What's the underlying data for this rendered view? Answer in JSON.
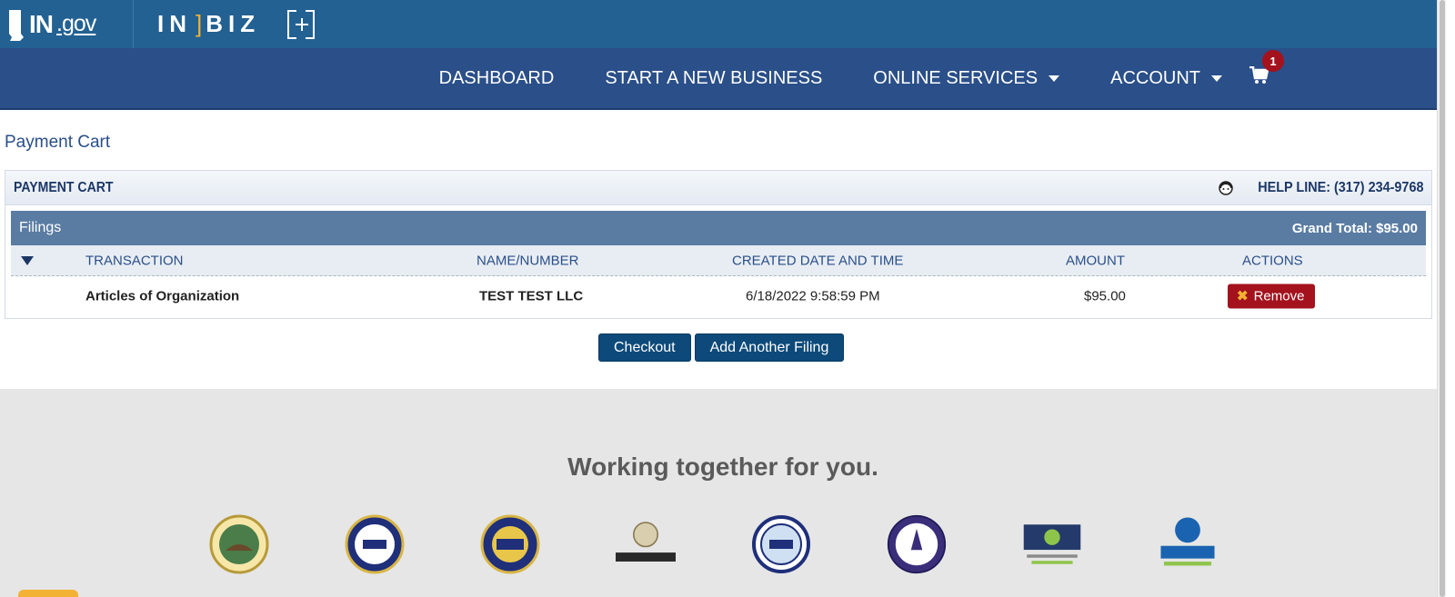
{
  "header": {
    "ingov_brand": "IN",
    "ingov_suffix": ".gov",
    "inbiz_left": "IN",
    "inbiz_bracket": "]",
    "inbiz_right": "BIZ"
  },
  "nav": {
    "items": [
      {
        "label": "DASHBOARD"
      },
      {
        "label": "START A NEW BUSINESS"
      },
      {
        "label": "ONLINE SERVICES"
      },
      {
        "label": "ACCOUNT"
      }
    ],
    "cart_count": "1"
  },
  "page": {
    "breadcrumb": "Payment Cart"
  },
  "panel": {
    "title": "PAYMENT CART",
    "helpline": "HELP LINE: (317) 234-9768",
    "filings_label": "Filings",
    "grand_total": "Grand Total: $95.00",
    "columns": [
      "TRANSACTION",
      "NAME/NUMBER",
      "CREATED DATE AND TIME",
      "AMOUNT",
      "ACTIONS"
    ],
    "rows": [
      {
        "transaction": "Articles of Organization",
        "name_number": "TEST TEST LLC",
        "created": "6/18/2022 9:58:59 PM",
        "amount": "$95.00",
        "action": "Remove"
      }
    ]
  },
  "actions": {
    "checkout": "Checkout",
    "add_filing": "Add Another Filing"
  },
  "footer": {
    "tagline": "Working together for you.",
    "logos": [
      "seal-of-indiana",
      "secretary-of-state",
      "dor",
      "workforce-development",
      "pla",
      "attorney-general",
      "iot",
      "indiana-sbdc"
    ]
  },
  "colors": {
    "topbar": "#236192",
    "nav": "#2a4f89",
    "filing_bar": "#5a7ca3",
    "remove": "#a3121d",
    "button": "#0d4a7a"
  }
}
